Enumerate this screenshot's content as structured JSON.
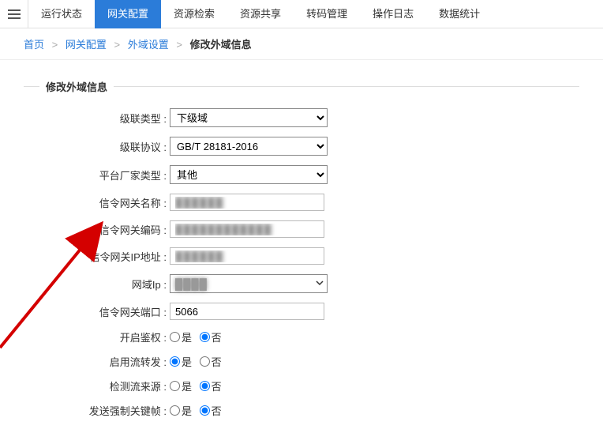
{
  "topnav": {
    "tabs": [
      {
        "label": "运行状态"
      },
      {
        "label": "网关配置"
      },
      {
        "label": "资源检索"
      },
      {
        "label": "资源共享"
      },
      {
        "label": "转码管理"
      },
      {
        "label": "操作日志"
      },
      {
        "label": "数据统计"
      }
    ],
    "active_index": 1
  },
  "breadcrumb": {
    "items": [
      {
        "label": "首页",
        "link": true
      },
      {
        "label": "网关配置",
        "link": true
      },
      {
        "label": "外域设置",
        "link": true
      },
      {
        "label": "修改外域信息",
        "link": false
      }
    ]
  },
  "section_title": "修改外域信息",
  "form": {
    "cascade_type": {
      "label": "级联类型 :",
      "value": "下级域"
    },
    "cascade_proto": {
      "label": "级联协议 :",
      "value": "GB/T 28181-2016"
    },
    "vendor_type": {
      "label": "平台厂家类型 :",
      "value": "其他"
    },
    "gw_name": {
      "label": "信令网关名称 :",
      "value": "██████"
    },
    "gw_code": {
      "label": "信令网关编码 :",
      "value": "████████████"
    },
    "gw_ip": {
      "label": "信令网关IP地址 :",
      "value": "██████"
    },
    "domain_ip": {
      "label": "网域Ip :",
      "value": "████"
    },
    "gw_port": {
      "label": "信令网关端口 :",
      "value": "5066"
    },
    "auth_enable": {
      "label": "开启鉴权 :",
      "options": [
        "是",
        "否"
      ],
      "selected": 1
    },
    "stream_forward": {
      "label": "启用流转发 :",
      "options": [
        "是",
        "否"
      ],
      "selected": 0
    },
    "detect_source": {
      "label": "检测流来源 :",
      "options": [
        "是",
        "否"
      ],
      "selected": 1
    },
    "force_keyframe": {
      "label": "发送强制关键帧 :",
      "options": [
        "是",
        "否"
      ],
      "selected": 1
    }
  }
}
